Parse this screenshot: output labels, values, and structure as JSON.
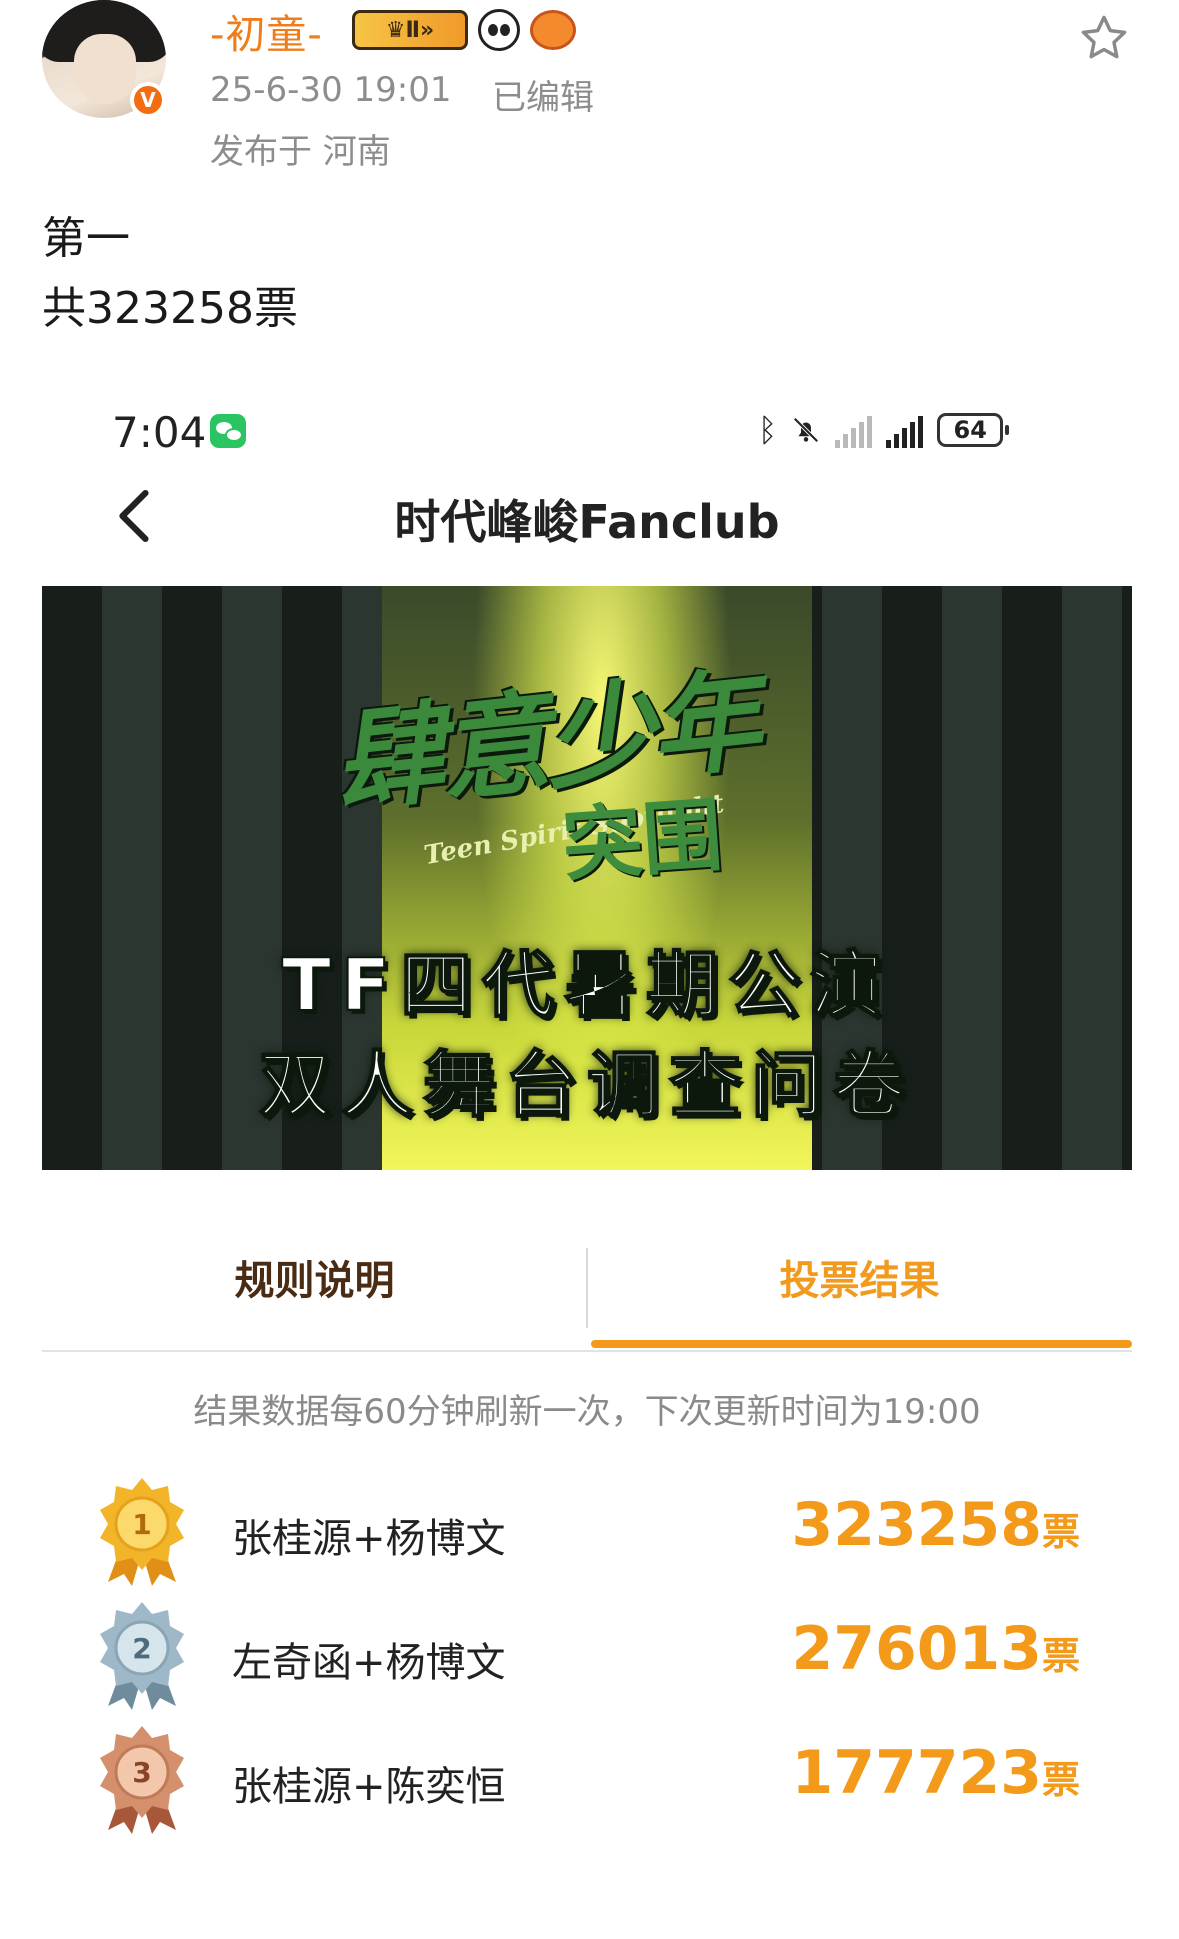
{
  "post": {
    "username": "-初童-",
    "badge_text": "Ⅱ",
    "time": "25-6-30 19:01",
    "edited": "已编辑",
    "location": "发布于 河南",
    "text_line1": "第一",
    "text_line2": "共323258票"
  },
  "phone": {
    "status_time": "7:04",
    "battery": "64",
    "nav_title": "时代峰峻Fanclub"
  },
  "banner": {
    "title_main": "肆意少年",
    "subtitle_en": "Teen Spirit Spotlight",
    "subtitle_cn": "突围",
    "line1": "TF四代暑期公演",
    "line2": "双人舞台调查问卷"
  },
  "tabs": {
    "rules": "规则说明",
    "results": "投票结果"
  },
  "notice": "结果数据每60分钟刷新一次，下次更新时间为19:00",
  "results": [
    {
      "rank": "1",
      "pair": "张桂源+杨博文",
      "votes": "323258",
      "unit": "票",
      "medal_color": "#f2b52a"
    },
    {
      "rank": "2",
      "pair": "左奇函+杨博文",
      "votes": "276013",
      "unit": "票",
      "medal_color": "#9fb8c7"
    },
    {
      "rank": "3",
      "pair": "张桂源+陈奕恒",
      "votes": "177723",
      "unit": "票",
      "medal_color": "#d48f6c"
    }
  ],
  "colors": {
    "accent": "#f39a1b",
    "username": "#f07d1b"
  }
}
